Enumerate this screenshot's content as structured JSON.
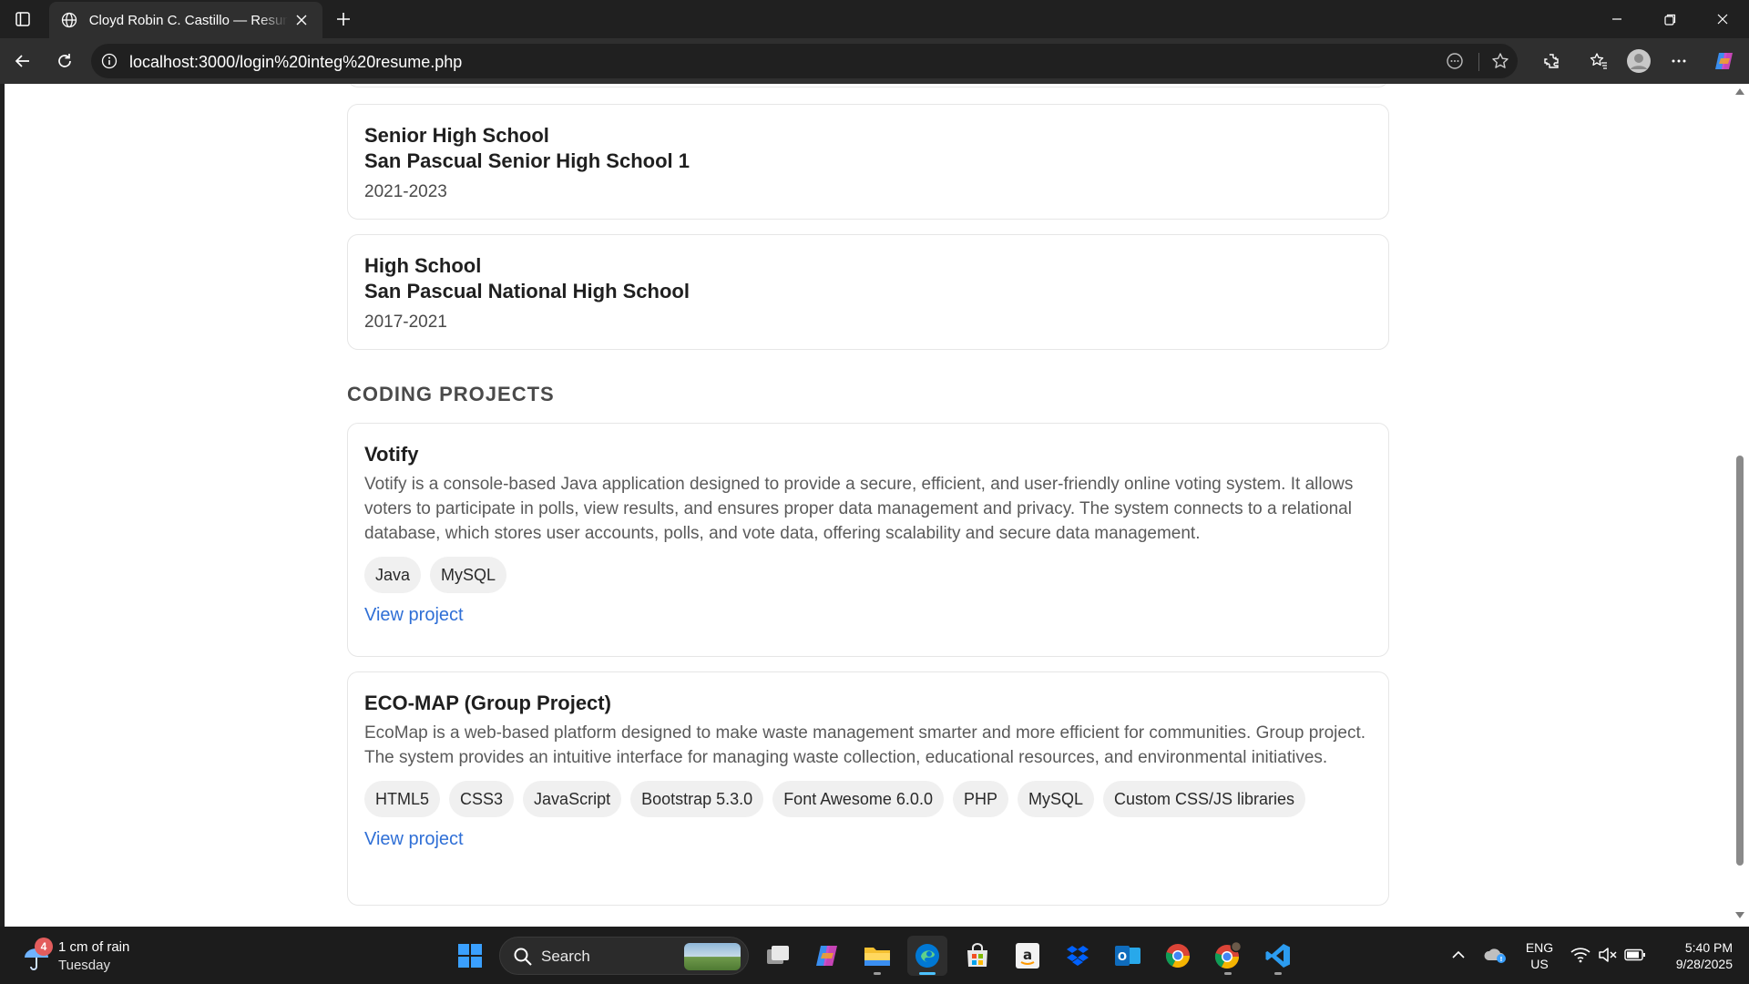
{
  "browser": {
    "tab_title": "Cloyd Robin C. Castillo — Resume",
    "url": "localhost:3000/login%20integ%20resume.php"
  },
  "education": [
    {
      "level": "Senior High School",
      "school": "San Pascual Senior High School 1",
      "years": "2021-2023"
    },
    {
      "level": "High School",
      "school": "San Pascual National High School",
      "years": "2017-2021"
    }
  ],
  "projects_section": {
    "title": "CODING PROJECTS",
    "projects": [
      {
        "title": "Votify",
        "description": "Votify is a console-based Java application designed to provide a secure, efficient, and user-friendly online voting system. It allows voters to participate in polls, view results, and ensures proper data management and privacy. The system connects to a relational database, which stores user accounts, polls, and vote data, offering scalability and secure data management.",
        "tags": [
          "Java",
          "MySQL"
        ],
        "link_label": "View project"
      },
      {
        "title": "ECO-MAP (Group Project)",
        "description": "EcoMap is a web-based platform designed to make waste management smarter and more efficient for communities. Group project. The system provides an intuitive interface for managing waste collection, educational resources, and environmental initiatives.",
        "tags": [
          "HTML5",
          "CSS3",
          "JavaScript",
          "Bootstrap 5.3.0",
          "Font Awesome 6.0.0",
          "PHP",
          "MySQL",
          "Custom CSS/JS libraries"
        ],
        "link_label": "View project"
      }
    ]
  },
  "taskbar": {
    "weather_badge": "4",
    "weather_text": "1 cm of rain",
    "weather_day": "Tuesday",
    "search_placeholder": "Search",
    "lang_line1": "ENG",
    "lang_line2": "US",
    "time": "5:40 PM",
    "date": "9/28/2025"
  },
  "colors": {
    "link": "#2f6fd6",
    "chip_bg": "#f0f0f0",
    "edge_accent": "#0078d4"
  }
}
